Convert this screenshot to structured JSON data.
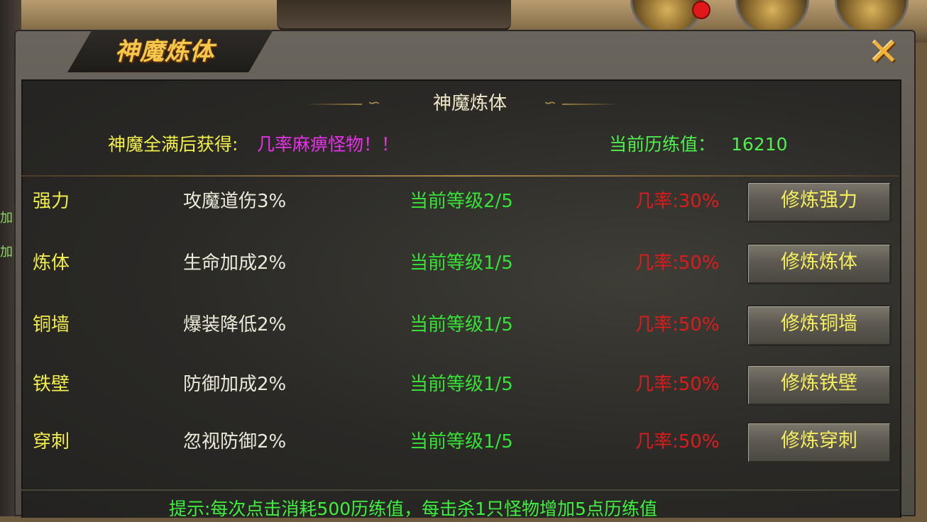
{
  "panel": {
    "tab_title": "神魔炼体",
    "header_title": "神魔炼体",
    "close_glyph": "✕"
  },
  "reward": {
    "label": "神魔全满后获得:",
    "value": "几率麻痹怪物！！"
  },
  "experience": {
    "label": "当前历练值：",
    "value": "16210"
  },
  "skills": [
    {
      "name": "强力",
      "effect": "攻魔道伤3%",
      "level": "当前等级2/5",
      "chance": "几率:30%",
      "button": "修炼强力"
    },
    {
      "name": "炼体",
      "effect": "生命加成2%",
      "level": "当前等级1/5",
      "chance": "几率:50%",
      "button": "修炼炼体"
    },
    {
      "name": "铜墙",
      "effect": "爆装降低2%",
      "level": "当前等级1/5",
      "chance": "几率:50%",
      "button": "修炼铜墙"
    },
    {
      "name": "铁壁",
      "effect": "防御加成2%",
      "level": "当前等级1/5",
      "chance": "几率:50%",
      "button": "修炼铁壁"
    },
    {
      "name": "穿刺",
      "effect": "忽视防御2%",
      "level": "当前等级1/5",
      "chance": "几率:50%",
      "button": "修炼穿刺"
    }
  ],
  "tip": "提示:每次点击消耗500历练值，每击杀1只怪物增加5点历练值",
  "background": {
    "left_fragments": [
      "加.",
      "加."
    ]
  },
  "colors": {
    "yellow_text": "#f2ee4a",
    "green_text": "#36e236",
    "red_text": "#dc1c1c",
    "magenta_text": "#e632e6",
    "title_gold": "#f4c84a"
  }
}
